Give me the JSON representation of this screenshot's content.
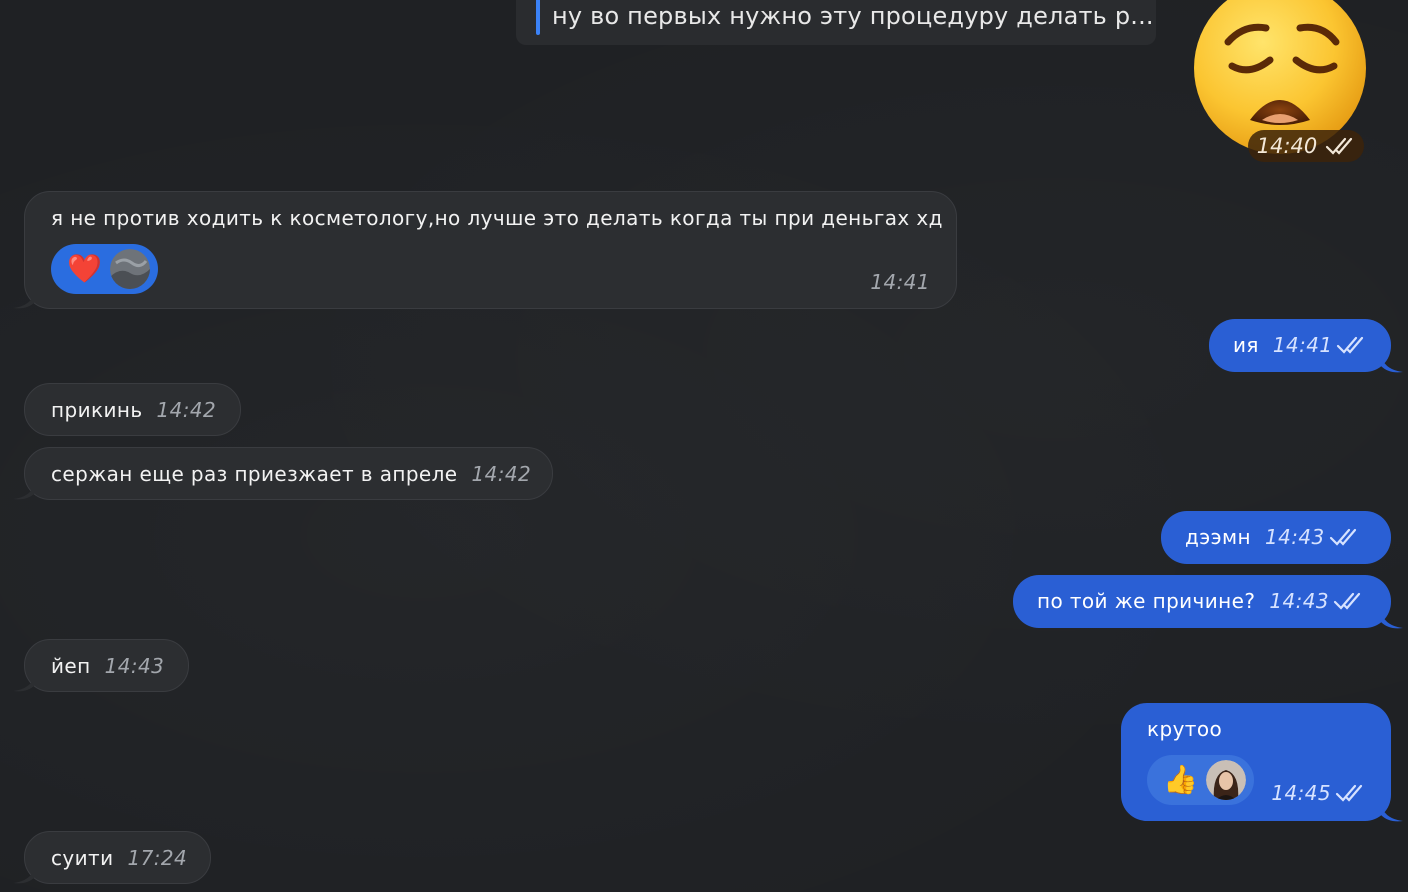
{
  "reply_preview": {
    "text": "ну во первых нужно эту процедуру делать р..."
  },
  "sticker": {
    "name": "weary-face-sticker",
    "time": "14:40"
  },
  "messages": [
    {
      "dir": "in",
      "text": "я не против ходить к косметологу,но лучше это делать когда ты при деньгах хд",
      "time": "14:41",
      "reaction": "❤️"
    },
    {
      "dir": "out",
      "text": "ия",
      "time": "14:41"
    },
    {
      "dir": "in",
      "text": "прикинь",
      "time": "14:42"
    },
    {
      "dir": "in",
      "text": "сержан еще раз приезжает в апреле",
      "time": "14:42"
    },
    {
      "dir": "out",
      "text": "дээмн",
      "time": "14:43"
    },
    {
      "dir": "out",
      "text": "по той же причине?",
      "time": "14:43"
    },
    {
      "dir": "in",
      "text": "йеп",
      "time": "14:43"
    },
    {
      "dir": "out",
      "text": "крутоо",
      "time": "14:45",
      "reaction": "👍"
    },
    {
      "dir": "in",
      "text": "суити",
      "time": "17:24"
    }
  ],
  "colors": {
    "background": "#1f2124",
    "incoming_bubble": "#2c2e31",
    "outgoing_bubble": "#2a5fd4",
    "reply_bar": "#3b82f6"
  }
}
